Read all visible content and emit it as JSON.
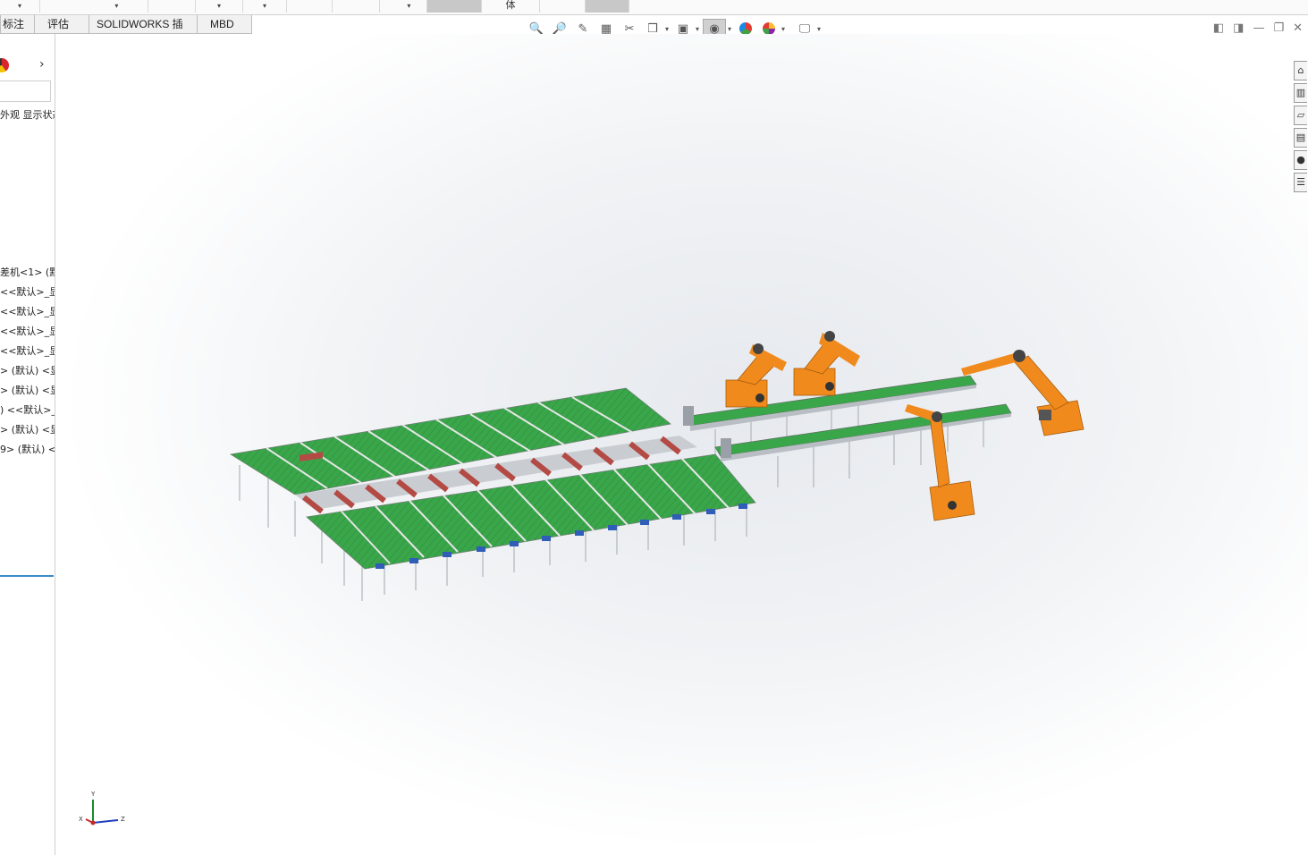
{
  "top_strip": {
    "fragment_label": "体"
  },
  "tabs": [
    "标注",
    "评估",
    "SOLIDWORKS 插件",
    "MBD"
  ],
  "view_toolbar": {
    "icons": [
      "zoom-to-fit-icon",
      "zoom-area-icon",
      "previous-view-icon",
      "section-view-icon",
      "dynamic-annotation-icon",
      "view-orientation-icon",
      "display-style-icon",
      "hide-show-icon",
      "edit-appearance-icon",
      "apply-scene-icon",
      "view-settings-icon"
    ]
  },
  "window_controls": {
    "icons": [
      "tile-left-icon",
      "tile-right-icon",
      "minimize-icon",
      "restore-icon",
      "close-icon"
    ]
  },
  "left_panel": {
    "header_text": "外观 显示状态",
    "tree_items": [
      "差机<1> (默",
      "<<默认>_显",
      "<<默认>_显",
      "<<默认>_显",
      "<<默认>_显",
      "> (默认) <显",
      "> (默认) <显",
      ") <<默认>_",
      "> (默认) <显",
      "9> (默认) <"
    ]
  },
  "task_pane": {
    "icons": [
      "home-icon",
      "design-library-icon",
      "file-explorer-icon",
      "view-palette-icon",
      "appearances-icon",
      "custom-properties-icon"
    ]
  },
  "triad": {
    "x": "X",
    "y": "Y",
    "z": "Z"
  },
  "colors": {
    "conveyor_green": "#3aa64a",
    "robot_orange": "#f08a1c",
    "frame_gray": "#b9bec4",
    "roller_red": "#b44a44",
    "motor_blue": "#2f5db8"
  }
}
